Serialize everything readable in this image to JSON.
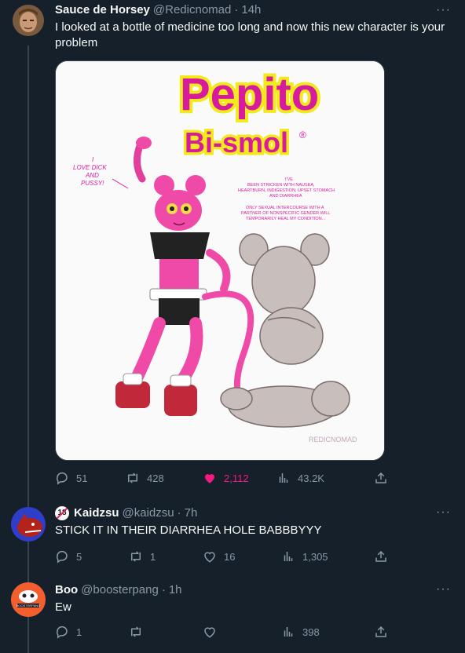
{
  "tweets": [
    {
      "name": "Sauce de Horsey",
      "handle": "@Redicnomad",
      "time": "14h",
      "text": "I looked at a bottle of medicine too long and now this new character is your problem",
      "stats": {
        "replies": "51",
        "retweets": "428",
        "likes": "2,112",
        "views": "43.2K"
      },
      "liked": true
    },
    {
      "name": "Kaidzsu",
      "handle": "@kaidzsu",
      "time": "7h",
      "text": "STICK IT IN THEIR DIARRHEA HOLE BABBBYYY",
      "stats": {
        "replies": "5",
        "retweets": "1",
        "likes": "16",
        "views": "1,305"
      },
      "badge": "18"
    },
    {
      "name": "Boo",
      "handle": "@boosterpang",
      "time": "1h",
      "text": "Ew",
      "stats": {
        "replies": "1",
        "retweets": "",
        "likes": "",
        "views": "398"
      },
      "avatar_text": "BOOSTERPANG"
    }
  ],
  "media": {
    "title_line1": "Pepito",
    "title_line2": "Bi-smol",
    "registered": "®",
    "speech": "I LOVE DICK AND PUSSY!",
    "side_note_1": "I'VE BEEN STRICKEN WITH NAUSEA, HEARTBURN, INDIGESTION, UPSET STOMACH AND DIARRHEA",
    "side_note_2": "ONLY SEXUAL INTERCOURSE WITH A PARTNER OF NONSPECIFIC GENDER WILL TEMPORARILY HEAL MY CONDITION...",
    "signature": "REDICNOMAD"
  },
  "colors": {
    "background": "#15202b",
    "muted": "#8b98a5",
    "like": "#f91880",
    "title_pink": "#d81b9e",
    "title_yellow": "#f2ea1d"
  },
  "icons": {
    "reply": "reply-icon",
    "retweet": "retweet-icon",
    "like": "heart-icon",
    "views": "views-icon",
    "share": "share-icon",
    "more": "more-icon"
  }
}
